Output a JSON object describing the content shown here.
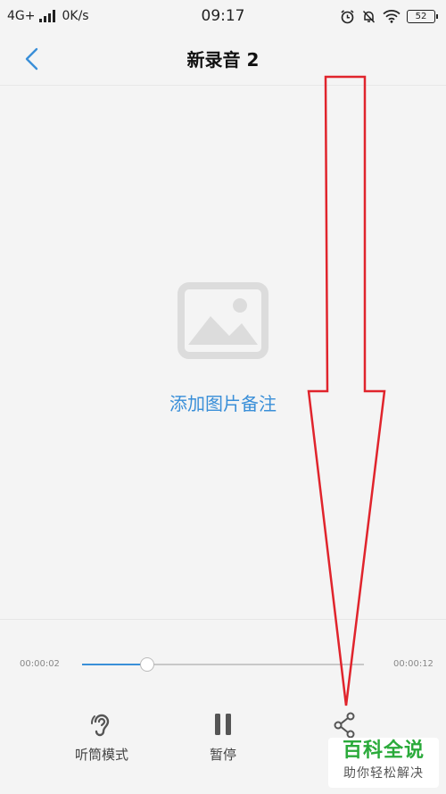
{
  "status_bar": {
    "network": "4G+",
    "speed": "0K/s",
    "time": "09:17",
    "battery": "52",
    "icons": [
      "alarm-icon",
      "mute-bell-icon",
      "wifi-icon"
    ]
  },
  "header": {
    "title": "新录音 2",
    "back_icon": "chevron-left-icon"
  },
  "main": {
    "placeholder_icon": "image-icon",
    "add_note_label": "添加图片备注"
  },
  "player": {
    "current_time": "00:00:02",
    "total_time": "00:00:12",
    "progress": 0.23,
    "accent_color": "#3a8fd8"
  },
  "controls": [
    {
      "label": "听筒模式",
      "icon": "ear-icon"
    },
    {
      "label": "暂停",
      "icon": "pause-icon"
    },
    {
      "label": "",
      "icon": "share-icon"
    }
  ],
  "annotation": {
    "arrow_color": "#e0242c"
  },
  "watermark": {
    "title": "百科全说",
    "subtitle": "助你轻松解决"
  }
}
